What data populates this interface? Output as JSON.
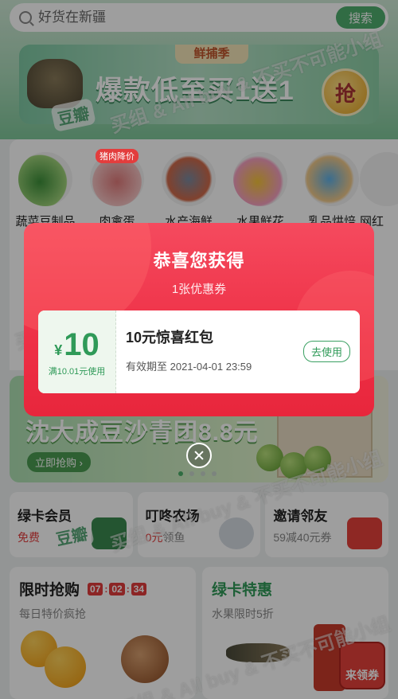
{
  "search": {
    "placeholder": "好货在新疆",
    "button_label": "搜索"
  },
  "banner": {
    "tag": "鲜捕季",
    "title": "爆款低至买1送1",
    "grab_label": "抢"
  },
  "categories": [
    {
      "label": "蔬菜豆制品"
    },
    {
      "label": "肉禽蛋",
      "badge": "猪肉降价"
    },
    {
      "label": "水产海鲜"
    },
    {
      "label": "水果鲜花"
    },
    {
      "label": "乳品烘焙"
    },
    {
      "label": "网红"
    }
  ],
  "promo": {
    "title": "沈大成豆沙青团8.8元",
    "button_label": "立即抢购 ›"
  },
  "quick_cards": [
    {
      "title": "绿卡会员",
      "sub_red": "免费",
      "sub_gray": ""
    },
    {
      "title": "叮咚农场",
      "sub_red": "0元",
      "sub_gray": "领鱼"
    },
    {
      "title": "邀请邻友",
      "sub_red": "59减40元",
      "sub_gray": "券"
    }
  ],
  "flash_sale": {
    "title": "限时抢购",
    "timer": [
      "07",
      "02",
      "34"
    ],
    "subtitle": "每日特价疯抢"
  },
  "green_card": {
    "title": "绿卡特惠",
    "subtitle": "水果限时5折",
    "claim_label": "来领券"
  },
  "watermark": {
    "text": "买组 & All buy & 不买不可能小组",
    "logo": "豆瓣"
  },
  "modal": {
    "title": "恭喜您获得",
    "subtitle": "1张优惠券",
    "coupon": {
      "currency": "¥",
      "amount": "10",
      "condition": "满10.01元使用",
      "name": "10元惊喜红包",
      "expiry": "有效期至 2021-04-01 23:59",
      "use_label": "去使用"
    }
  },
  "colors": {
    "accent_green": "#2f9a58",
    "modal_red": "#ee3046"
  }
}
